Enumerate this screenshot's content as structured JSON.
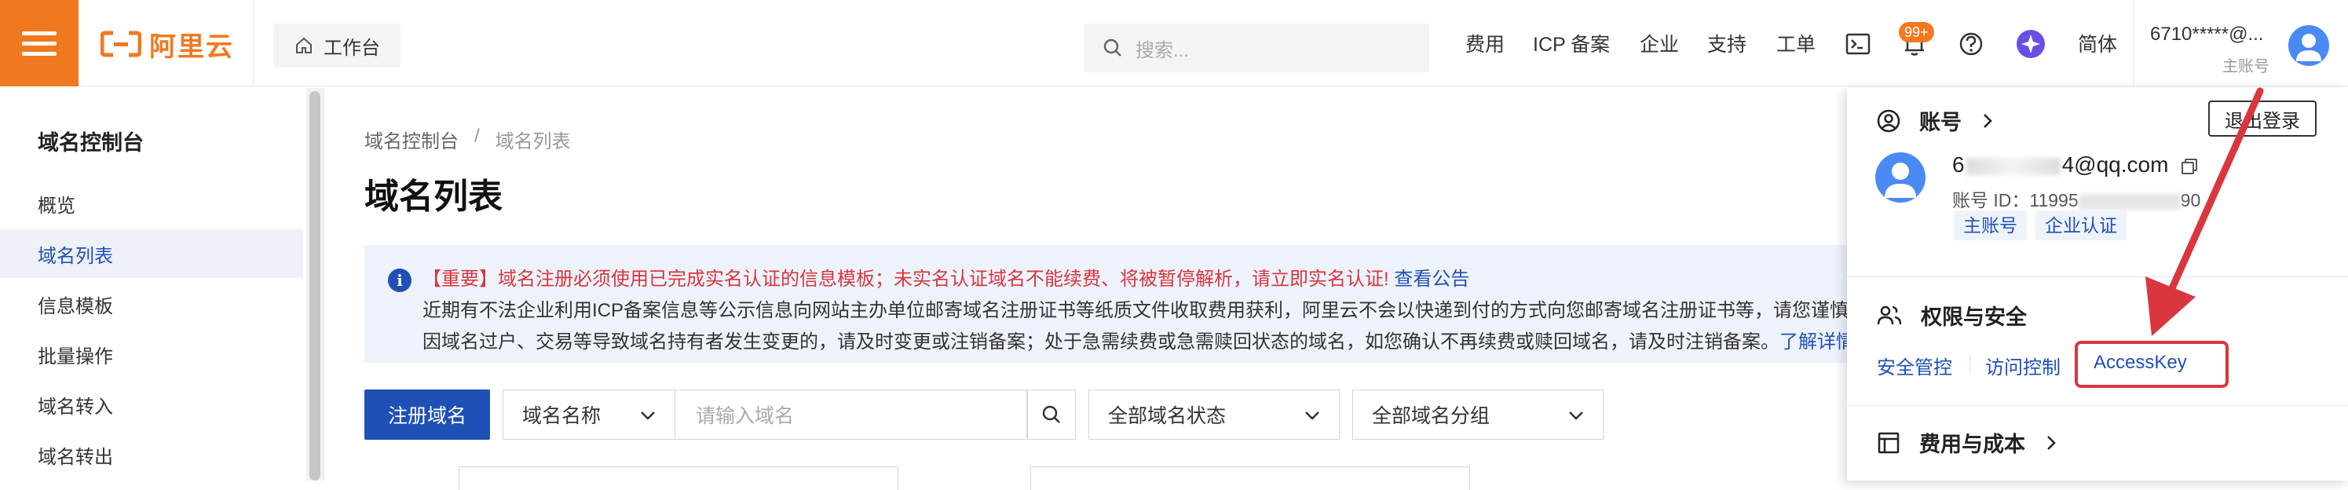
{
  "header": {
    "brand": "阿里云",
    "workbench": "工作台",
    "search_placeholder": "搜索...",
    "nav": [
      "费用",
      "ICP 备案",
      "企业",
      "支持",
      "工单"
    ],
    "badge": "99+",
    "lang": "简体",
    "account_name": "6710*****@...",
    "account_sub": "主账号"
  },
  "sidebar": {
    "title": "域名控制台",
    "items": [
      {
        "label": "概览",
        "active": false
      },
      {
        "label": "域名列表",
        "active": true
      },
      {
        "label": "信息模板",
        "active": false
      },
      {
        "label": "批量操作",
        "active": false
      },
      {
        "label": "域名转入",
        "active": false
      },
      {
        "label": "域名转出",
        "active": false
      }
    ]
  },
  "main": {
    "breadcrumb": [
      "域名控制台",
      "/",
      "域名列表"
    ],
    "title": "域名列表",
    "notice": {
      "important": "【重要】域名注册必须使用已完成实名认证的信息模板；未实名认证域名不能续费、将被暂停解析，请立即实名认证!",
      "important_link": "查看公告",
      "line2": "近期有不法企业利用ICP备案信息等公示信息向网站主办单位邮寄域名注册证书等纸质文件收取费用获利，阿里云不会以快递到付的方式向您邮寄域名注册证书等，请您谨慎",
      "line3": "因域名过户、交易等导致域名持有者发生变更的，请及时变更或注销备案；处于急需续费或急需赎回状态的域名，如您确认不再续费或赎回域名，请及时注销备案。",
      "line3_link": "了解详情"
    },
    "register_button": "注册域名",
    "name_select": "域名名称",
    "search_placeholder": "请输入域名",
    "status_select": "全部域名状态",
    "group_select": "全部域名分组"
  },
  "panel": {
    "account_header": "账号",
    "logout": "退出登录",
    "email_prefix": "6",
    "email_suffix": "4@qq.com",
    "account_id_label": "账号 ID：",
    "account_id_prefix": "11995",
    "account_id_suffix": "90",
    "tags": [
      "主账号",
      "企业认证"
    ],
    "security_header": "权限与安全",
    "links": [
      "安全管控",
      "访问控制",
      "AccessKey"
    ],
    "cost_header": "费用与成本"
  },
  "colors": {
    "brand_orange": "#f0791f",
    "primary_blue": "#1f50b6",
    "alert_red": "#d9363e"
  }
}
